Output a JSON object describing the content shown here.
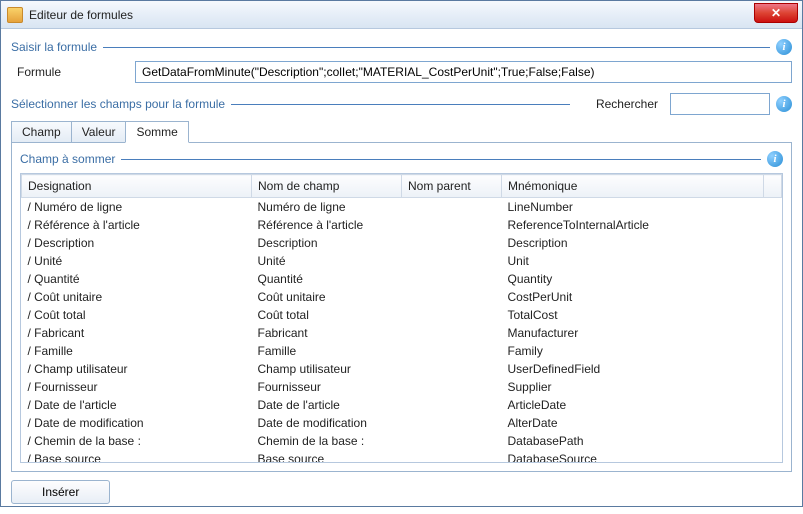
{
  "window": {
    "title": "Editeur de formules",
    "close_glyph": "✕"
  },
  "section1": {
    "title": "Saisir la formule",
    "formula_label": "Formule",
    "formula_value": "GetDataFromMinute(\"Description\";colIet;\"MATERIAL_CostPerUnit\";True;False;False)",
    "info_glyph": "i"
  },
  "section2": {
    "title": "Sélectionner les champs pour la formule",
    "search_label": "Rechercher",
    "search_value": "",
    "info_glyph": "i"
  },
  "tabs": {
    "items": [
      "Champ",
      "Valeur",
      "Somme"
    ],
    "active_index": 2
  },
  "section3": {
    "title": "Champ à sommer",
    "info_glyph": "i"
  },
  "table": {
    "columns": [
      "Designation",
      "Nom de champ",
      "Nom parent",
      "Mnémonique"
    ],
    "col_widths": [
      "230px",
      "150px",
      "100px",
      "auto"
    ],
    "rows": [
      {
        "designation": "/ Numéro de ligne",
        "nom": "Numéro de ligne",
        "parent": "",
        "mnemo": "LineNumber"
      },
      {
        "designation": "/ Référence à l'article",
        "nom": "Référence à l'article",
        "parent": "",
        "mnemo": "ReferenceToInternalArticle"
      },
      {
        "designation": "/ Description",
        "nom": "Description",
        "parent": "",
        "mnemo": "Description"
      },
      {
        "designation": "/ Unité",
        "nom": "Unité",
        "parent": "",
        "mnemo": "Unit"
      },
      {
        "designation": "/ Quantité",
        "nom": "Quantité",
        "parent": "",
        "mnemo": "Quantity"
      },
      {
        "designation": "/ Coût unitaire",
        "nom": "Coût unitaire",
        "parent": "",
        "mnemo": "CostPerUnit"
      },
      {
        "designation": "/ Coût total",
        "nom": "Coût total",
        "parent": "",
        "mnemo": "TotalCost"
      },
      {
        "designation": "/ Fabricant",
        "nom": "Fabricant",
        "parent": "",
        "mnemo": "Manufacturer"
      },
      {
        "designation": "/ Famille",
        "nom": "Famille",
        "parent": "",
        "mnemo": "Family"
      },
      {
        "designation": "/ Champ utilisateur",
        "nom": "Champ utilisateur",
        "parent": "",
        "mnemo": "UserDefinedField"
      },
      {
        "designation": "/ Fournisseur",
        "nom": "Fournisseur",
        "parent": "",
        "mnemo": "Supplier"
      },
      {
        "designation": "/ Date de l'article",
        "nom": "Date de l'article",
        "parent": "",
        "mnemo": "ArticleDate"
      },
      {
        "designation": "/ Date de modification",
        "nom": "Date de modification",
        "parent": "",
        "mnemo": "AlterDate"
      },
      {
        "designation": "/ Chemin de la base :",
        "nom": "Chemin de la base :",
        "parent": "",
        "mnemo": "DatabasePath"
      },
      {
        "designation": "/ Base source",
        "nom": "Base source",
        "parent": "",
        "mnemo": "DatabaseSource"
      }
    ]
  },
  "buttons": {
    "insert": "Insérer"
  }
}
